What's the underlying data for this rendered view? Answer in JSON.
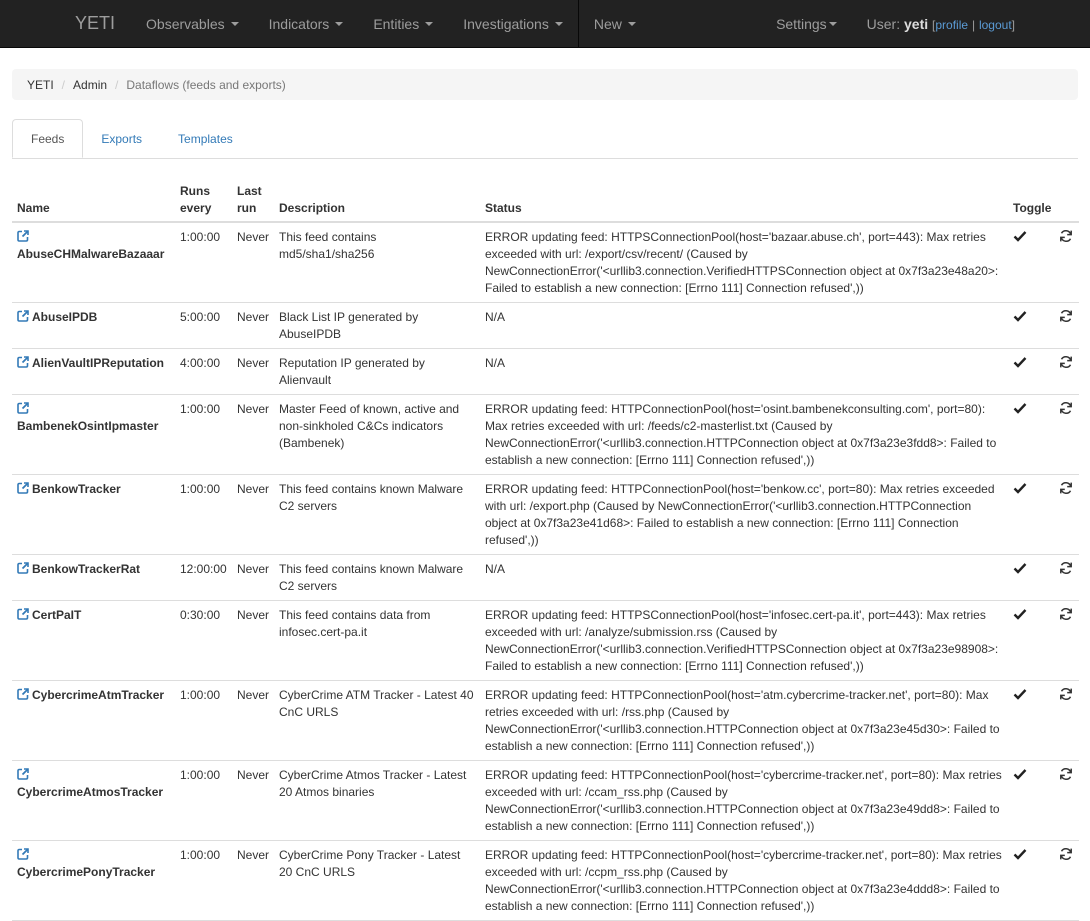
{
  "navbar": {
    "brand": "YETI",
    "menus": [
      "Observables",
      "Indicators",
      "Entities",
      "Investigations",
      "New"
    ],
    "settings": "Settings",
    "user_label": "User:",
    "username": "yeti",
    "bracket_open": "[",
    "profile": "profile",
    "pipe": "|",
    "logout": "logout",
    "bracket_close": "]"
  },
  "breadcrumb": [
    "YETI",
    "Admin",
    "Dataflows (feeds and exports)"
  ],
  "tabs": [
    "Feeds",
    "Exports",
    "Templates"
  ],
  "table": {
    "headers": {
      "name": "Name",
      "runs_every": "Runs every",
      "last_run": "Last run",
      "description": "Description",
      "status": "Status",
      "toggle": "Toggle"
    },
    "rows": [
      {
        "name": "AbuseCHMalwareBazaaar",
        "runs": "1:00:00",
        "last": "Never",
        "desc": "This feed contains md5/sha1/sha256",
        "status": "ERROR updating feed: HTTPSConnectionPool(host='bazaar.abuse.ch', port=443): Max retries exceeded with url: /export/csv/recent/ (Caused by NewConnectionError('<urllib3.connection.VerifiedHTTPSConnection object at 0x7f3a23e48a20>: Failed to establish a new connection: [Errno 111] Connection refused',))",
        "wrap": true
      },
      {
        "name": "AbuseIPDB",
        "runs": "5:00:00",
        "last": "Never",
        "desc": "Black List IP generated by AbuseIPDB",
        "status": "N/A",
        "wrap": false
      },
      {
        "name": "AlienVaultIPReputation",
        "runs": "4:00:00",
        "last": "Never",
        "desc": "Reputation IP generated by Alienvault",
        "status": "N/A",
        "wrap": false
      },
      {
        "name": "BambenekOsintIpmaster",
        "runs": "1:00:00",
        "last": "Never",
        "desc": "Master Feed of known, active and non-sinkholed C&Cs indicators (Bambenek)",
        "status": "ERROR updating feed: HTTPConnectionPool(host='osint.bambenekconsulting.com', port=80): Max retries exceeded with url: /feeds/c2-masterlist.txt (Caused by NewConnectionError('<urllib3.connection.HTTPConnection object at 0x7f3a23e3fdd8>: Failed to establish a new connection: [Errno 111] Connection refused',))",
        "wrap": true
      },
      {
        "name": "BenkowTracker",
        "runs": "1:00:00",
        "last": "Never",
        "desc": "This feed contains known Malware C2 servers",
        "status": "ERROR updating feed: HTTPConnectionPool(host='benkow.cc', port=80): Max retries exceeded with url: /export.php (Caused by NewConnectionError('<urllib3.connection.HTTPConnection object at 0x7f3a23e41d68>: Failed to establish a new connection: [Errno 111] Connection refused',))",
        "wrap": false
      },
      {
        "name": "BenkowTrackerRat",
        "runs": "12:00:00",
        "last": "Never",
        "desc": "This feed contains known Malware C2 servers",
        "status": "N/A",
        "wrap": false
      },
      {
        "name": "CertPaIT",
        "runs": "0:30:00",
        "last": "Never",
        "desc": "This feed contains data from infosec.cert-pa.it",
        "status": "ERROR updating feed: HTTPSConnectionPool(host='infosec.cert-pa.it', port=443): Max retries exceeded with url: /analyze/submission.rss (Caused by NewConnectionError('<urllib3.connection.VerifiedHTTPSConnection object at 0x7f3a23e98908>: Failed to establish a new connection: [Errno 111] Connection refused',))",
        "wrap": false
      },
      {
        "name": "CybercrimeAtmTracker",
        "runs": "1:00:00",
        "last": "Never",
        "desc": "CyberCrime ATM Tracker - Latest 40 CnC URLS",
        "status": "ERROR updating feed: HTTPConnectionPool(host='atm.cybercrime-tracker.net', port=80): Max retries exceeded with url: /rss.php (Caused by NewConnectionError('<urllib3.connection.HTTPConnection object at 0x7f3a23e45d30>: Failed to establish a new connection: [Errno 111] Connection refused',))",
        "wrap": false
      },
      {
        "name": "CybercrimeAtmosTracker",
        "runs": "1:00:00",
        "last": "Never",
        "desc": "CyberCrime Atmos Tracker - Latest 20 Atmos binaries",
        "status": "ERROR updating feed: HTTPConnectionPool(host='cybercrime-tracker.net', port=80): Max retries exceeded with url: /ccam_rss.php (Caused by NewConnectionError('<urllib3.connection.HTTPConnection object at 0x7f3a23e49dd8>: Failed to establish a new connection: [Errno 111] Connection refused',))",
        "wrap": true
      },
      {
        "name": "CybercrimePonyTracker",
        "runs": "1:00:00",
        "last": "Never",
        "desc": "CyberCrime Pony Tracker - Latest 20 CnC URLS",
        "status": "ERROR updating feed: HTTPConnectionPool(host='cybercrime-tracker.net', port=80): Max retries exceeded with url: /ccpm_rss.php (Caused by NewConnectionError('<urllib3.connection.HTTPConnection object at 0x7f3a23e4ddd8>: Failed to establish a new connection: [Errno 111] Connection refused',))",
        "wrap": false
      }
    ]
  }
}
